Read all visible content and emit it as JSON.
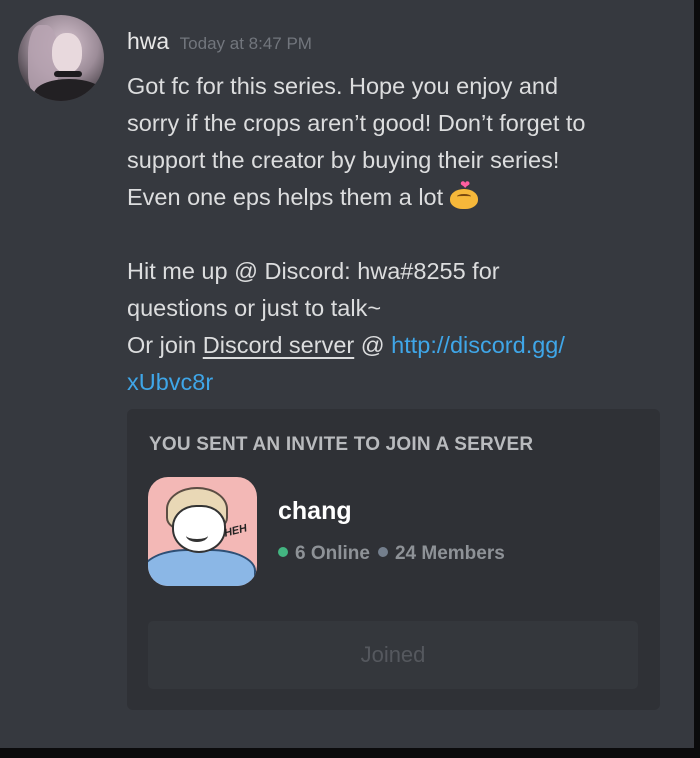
{
  "message": {
    "author": "hwa",
    "timestamp": "Today at 8:47 PM",
    "lines": [
      "Got fc for this series. Hope you enjoy and",
      "sorry if the crops aren’t good! Don’t forget to",
      "support the creator by buying their series!",
      "Even one eps helps them a lot"
    ],
    "contact_lines": [
      "Hit me up @ Discord: hwa#8255 for",
      "questions or just to talk~"
    ],
    "join_prefix": "Or join ",
    "join_link_text": "Discord server",
    "join_at": " @ ",
    "url_part1": "http://discord.gg/",
    "url_part2": "xUbvc8r",
    "emoji": "cute-crying-face-with-heart"
  },
  "invite": {
    "header": "YOU SENT AN INVITE TO JOIN A SERVER",
    "server_name": "chang",
    "online": "6 Online",
    "members": "24 Members",
    "button_label": "Joined",
    "server_icon_text": "HEH"
  },
  "colors": {
    "background": "#36393f",
    "embed": "#2f3136",
    "link": "#3fa6e8",
    "online": "#43b581"
  }
}
